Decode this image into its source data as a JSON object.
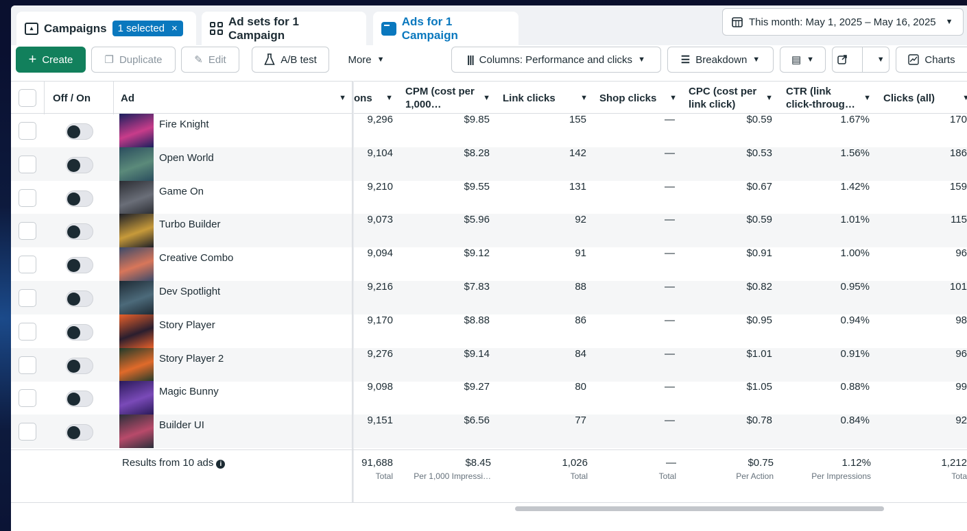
{
  "tabs": {
    "campaigns": {
      "label": "Campaigns",
      "badge": "1 selected",
      "badge_close": "×"
    },
    "adsets": {
      "label": "Ad sets for 1 Campaign"
    },
    "ads": {
      "label": "Ads for 1 Campaign"
    }
  },
  "date_range": {
    "label": "This month: May 1, 2025 – May 16, 2025"
  },
  "toolbar": {
    "create": "Create",
    "duplicate": "Duplicate",
    "edit": "Edit",
    "abtest": "A/B test",
    "more": "More",
    "columns": "Columns: Performance and clicks",
    "breakdown": "Breakdown",
    "charts": "Charts"
  },
  "headers": {
    "offon": "Off / On",
    "ad": "Ad",
    "impressions": "ons",
    "cpm": "CPM (cost per 1,000…",
    "link_clicks": "Link clicks",
    "shop_clicks": "Shop clicks",
    "cpc": "CPC (cost per link click)",
    "ctr": "CTR (link click-throug…",
    "clicks_all": "Clicks (all)"
  },
  "rows": [
    {
      "name": "Fire Knight",
      "impressions": "9,296",
      "cpm": "$9.85",
      "link_clicks": "155",
      "shop_clicks": "—",
      "cpc": "$0.59",
      "ctr": "1.67%",
      "clicks_all": "170"
    },
    {
      "name": "Open World",
      "impressions": "9,104",
      "cpm": "$8.28",
      "link_clicks": "142",
      "shop_clicks": "—",
      "cpc": "$0.53",
      "ctr": "1.56%",
      "clicks_all": "186"
    },
    {
      "name": "Game On",
      "impressions": "9,210",
      "cpm": "$9.55",
      "link_clicks": "131",
      "shop_clicks": "—",
      "cpc": "$0.67",
      "ctr": "1.42%",
      "clicks_all": "159"
    },
    {
      "name": "Turbo Builder",
      "impressions": "9,073",
      "cpm": "$5.96",
      "link_clicks": "92",
      "shop_clicks": "—",
      "cpc": "$0.59",
      "ctr": "1.01%",
      "clicks_all": "115"
    },
    {
      "name": "Creative Combo",
      "impressions": "9,094",
      "cpm": "$9.12",
      "link_clicks": "91",
      "shop_clicks": "—",
      "cpc": "$0.91",
      "ctr": "1.00%",
      "clicks_all": "96"
    },
    {
      "name": "Dev Spotlight",
      "impressions": "9,216",
      "cpm": "$7.83",
      "link_clicks": "88",
      "shop_clicks": "—",
      "cpc": "$0.82",
      "ctr": "0.95%",
      "clicks_all": "101"
    },
    {
      "name": "Story Player",
      "impressions": "9,170",
      "cpm": "$8.88",
      "link_clicks": "86",
      "shop_clicks": "—",
      "cpc": "$0.95",
      "ctr": "0.94%",
      "clicks_all": "98"
    },
    {
      "name": "Story Player 2",
      "impressions": "9,276",
      "cpm": "$9.14",
      "link_clicks": "84",
      "shop_clicks": "—",
      "cpc": "$1.01",
      "ctr": "0.91%",
      "clicks_all": "96"
    },
    {
      "name": "Magic Bunny",
      "impressions": "9,098",
      "cpm": "$9.27",
      "link_clicks": "80",
      "shop_clicks": "—",
      "cpc": "$1.05",
      "ctr": "0.88%",
      "clicks_all": "99"
    },
    {
      "name": "Builder UI",
      "impressions": "9,151",
      "cpm": "$6.56",
      "link_clicks": "77",
      "shop_clicks": "—",
      "cpc": "$0.78",
      "ctr": "0.84%",
      "clicks_all": "92"
    }
  ],
  "summary": {
    "label": "Results from 10 ads",
    "impressions": "91,688",
    "impressions_sub": "Total",
    "cpm": "$8.45",
    "cpm_sub": "Per 1,000 Impressi…",
    "link_clicks": "1,026",
    "link_clicks_sub": "Total",
    "shop_clicks": "—",
    "shop_clicks_sub": "Total",
    "cpc": "$0.75",
    "cpc_sub": "Per Action",
    "ctr": "1.12%",
    "ctr_sub": "Per Impressions",
    "clicks_all": "1,212",
    "clicks_all_sub": "Tota"
  },
  "thumb_colors": [
    [
      "#1a1f5e",
      "#c83c8a"
    ],
    [
      "#2a4d5e",
      "#5b8a7a"
    ],
    [
      "#2b2d33",
      "#6a6e78"
    ],
    [
      "#1d1f27",
      "#c79a3a"
    ],
    [
      "#3a4a6a",
      "#d8765a"
    ],
    [
      "#1e2a34",
      "#4c6a7a"
    ],
    [
      "#e8602a",
      "#2a1e2e"
    ],
    [
      "#1f3a2a",
      "#e06a2a"
    ],
    [
      "#2a1a5a",
      "#7a4ab8"
    ],
    [
      "#2a2f3a",
      "#b84a6a"
    ]
  ]
}
